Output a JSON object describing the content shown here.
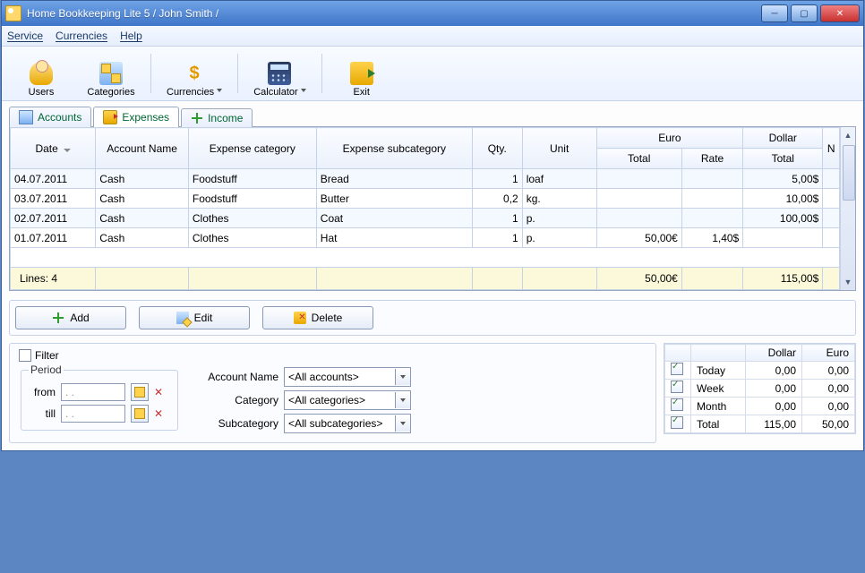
{
  "title": "Home Bookkeeping Lite 5  / John Smith /",
  "menu": {
    "service": "Service",
    "currencies": "Currencies",
    "help": "Help"
  },
  "toolbar": {
    "users": "Users",
    "categories": "Categories",
    "currencies": "Currencies",
    "calculator": "Calculator",
    "exit": "Exit"
  },
  "tabs": {
    "accounts": "Accounts",
    "expenses": "Expenses",
    "income": "Income"
  },
  "grid": {
    "headers": {
      "date": "Date",
      "account": "Account Name",
      "category": "Expense category",
      "subcategory": "Expense subcategory",
      "qty": "Qty.",
      "unit": "Unit",
      "euro": "Euro",
      "euro_total": "Total",
      "rate": "Rate",
      "dollar": "Dollar",
      "dollar_total": "Total",
      "n": "N"
    },
    "rows": [
      {
        "date": "04.07.2011",
        "account": "Cash",
        "category": "Foodstuff",
        "subcategory": "Bread",
        "qty": "1",
        "unit": "loaf",
        "euro_total": "",
        "rate": "",
        "dollar_total": "5,00$"
      },
      {
        "date": "03.07.2011",
        "account": "Cash",
        "category": "Foodstuff",
        "subcategory": "Butter",
        "qty": "0,2",
        "unit": "kg.",
        "euro_total": "",
        "rate": "",
        "dollar_total": "10,00$"
      },
      {
        "date": "02.07.2011",
        "account": "Cash",
        "category": "Clothes",
        "subcategory": "Coat",
        "qty": "1",
        "unit": "p.",
        "euro_total": "",
        "rate": "",
        "dollar_total": "100,00$"
      },
      {
        "date": "01.07.2011",
        "account": "Cash",
        "category": "Clothes",
        "subcategory": "Hat",
        "qty": "1",
        "unit": "p.",
        "euro_total": "50,00€",
        "rate": "1,40$",
        "dollar_total": ""
      }
    ],
    "footer": {
      "lines_label": "Lines: 4",
      "euro_total": "50,00€",
      "dollar_total": "115,00$"
    }
  },
  "actions": {
    "add": "Add",
    "edit": "Edit",
    "del": "Delete"
  },
  "filter": {
    "label": "Filter",
    "period_label": "Period",
    "from": "from",
    "till": "till",
    "date_placeholder": ".  .",
    "account_label": "Account Name",
    "account_value": "<All accounts>",
    "category_label": "Category",
    "category_value": "<All categories>",
    "subcategory_label": "Subcategory",
    "subcategory_value": "<All subcategories>"
  },
  "summary": {
    "head_dollar": "Dollar",
    "head_euro": "Euro",
    "rows": [
      {
        "label": "Today",
        "dollar": "0,00",
        "euro": "0,00"
      },
      {
        "label": "Week",
        "dollar": "0,00",
        "euro": "0,00"
      },
      {
        "label": "Month",
        "dollar": "0,00",
        "euro": "0,00"
      },
      {
        "label": "Total",
        "dollar": "115,00",
        "euro": "50,00"
      }
    ]
  }
}
